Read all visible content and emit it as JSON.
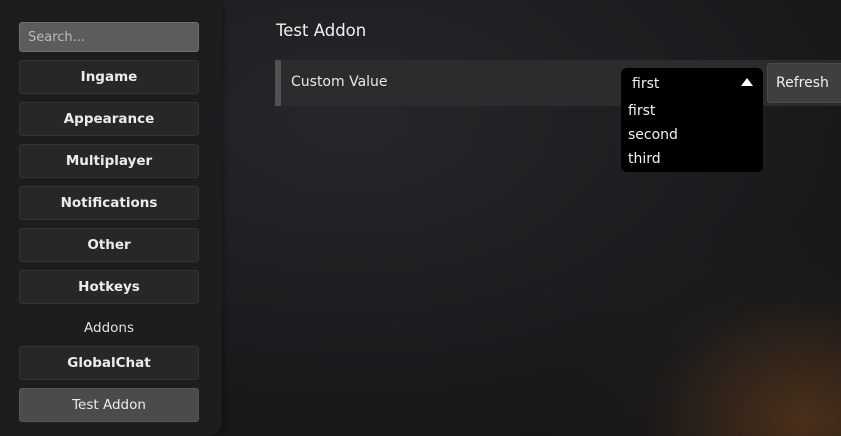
{
  "sidebar": {
    "search_placeholder": "Search...",
    "items": [
      {
        "label": "Ingame"
      },
      {
        "label": "Appearance"
      },
      {
        "label": "Multiplayer"
      },
      {
        "label": "Notifications"
      },
      {
        "label": "Other"
      },
      {
        "label": "Hotkeys"
      }
    ],
    "addons_heading": "Addons",
    "addons": [
      {
        "label": "GlobalChat"
      },
      {
        "label": "Test Addon",
        "active": true
      }
    ]
  },
  "main": {
    "title": "Test Addon",
    "setting": {
      "label": "Custom Value",
      "selected_value": "first",
      "options": [
        "first",
        "second",
        "third"
      ],
      "refresh_label": "Refresh"
    }
  },
  "colors": {
    "sidebar_bg": "#1c1d1f",
    "button_bg": "#262729",
    "active_button_bg": "#4a4b4d",
    "dropdown_bg": "#000000"
  },
  "icons": {
    "dropdown_caret": "caret-up-icon"
  }
}
